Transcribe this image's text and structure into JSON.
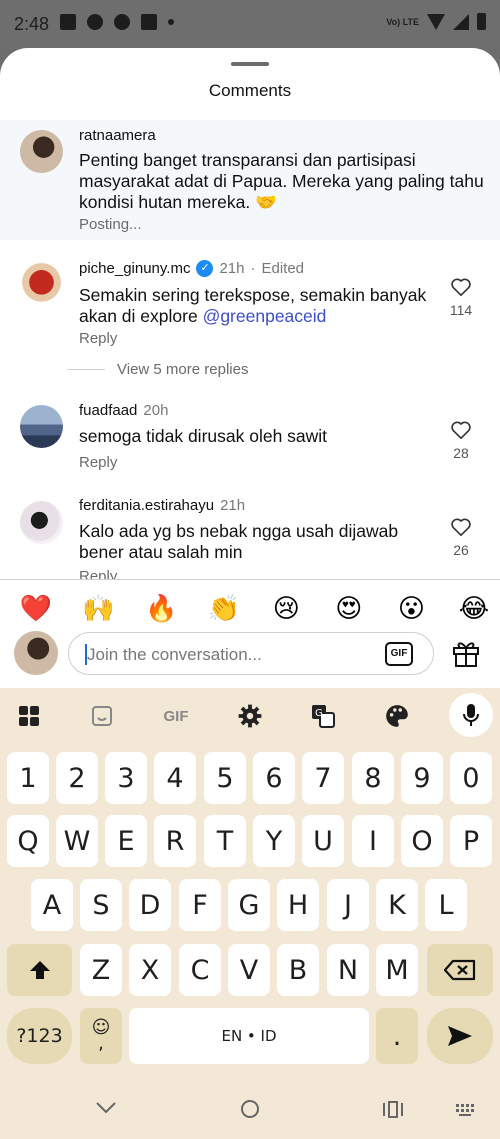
{
  "status_bar": {
    "time": "2:48",
    "network": "Vo) LTE"
  },
  "sheet": {
    "title": "Comments"
  },
  "comments": [
    {
      "username": "ratnaamera",
      "text": "Penting banget transparansi dan partisipasi masyarakat adat di Papua. Mereka yang paling tahu kondisi hutan mereka. 🤝",
      "status": "Posting..."
    },
    {
      "username": "piche_ginuny.mc",
      "time": "21h",
      "edited": "Edited",
      "text_before": "Semakin sering terekspose, semakin banyak akan di explore ",
      "mention": "@greenpeaceid",
      "reply": "Reply",
      "likes": "114",
      "view_more": "View 5 more replies"
    },
    {
      "username": "fuadfaad",
      "time": "20h",
      "text": "semoga tidak dirusak oleh sawit",
      "reply": "Reply",
      "likes": "28"
    },
    {
      "username": "ferditania.estirahayu",
      "time": "21h",
      "text": "Kalo ada yg bs nebak ngga usah dijawab bener atau salah min",
      "reply": "Reply",
      "likes": "26"
    }
  ],
  "emoji_bar": [
    "❤️",
    "🙌",
    "🔥",
    "👏",
    "😢",
    "😍",
    "😮",
    "😂"
  ],
  "composer": {
    "placeholder": "Join the conversation...",
    "gif_label": "GIF"
  },
  "keyboard": {
    "toolbar": {
      "gif_label": "GIF"
    },
    "rows": {
      "numbers": [
        "1",
        "2",
        "3",
        "4",
        "5",
        "6",
        "7",
        "8",
        "9",
        "0"
      ],
      "row1": [
        "Q",
        "W",
        "E",
        "R",
        "T",
        "Y",
        "U",
        "I",
        "O",
        "P"
      ],
      "row2": [
        "A",
        "S",
        "D",
        "F",
        "G",
        "H",
        "J",
        "K",
        "L"
      ],
      "row3": [
        "Z",
        "X",
        "C",
        "V",
        "B",
        "N",
        "M"
      ]
    },
    "symbols_label": "?123",
    "comma_label": ",",
    "space_label": "EN • ID",
    "period_label": "."
  },
  "colors": {
    "accent": "#1d8cf0",
    "mention": "#3c4ec8",
    "keyboard_bg": "#f2e8d5",
    "func_key": "#e6dab5"
  }
}
